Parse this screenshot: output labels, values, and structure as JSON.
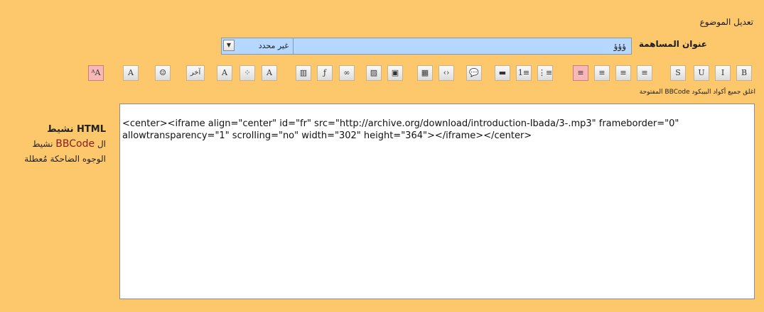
{
  "page_title": "تعديل الموضوع",
  "subject": {
    "label": "عنوان المساهمة",
    "value": "ؤؤؤ",
    "prefix_selected": "غير محدد"
  },
  "toolbar": {
    "buttons": [
      {
        "icon": "bold-icon",
        "glyph": "B"
      },
      {
        "icon": "italic-icon",
        "glyph": "I"
      },
      {
        "icon": "underline-icon",
        "glyph": "U"
      },
      {
        "icon": "strikethrough-icon",
        "glyph": "S"
      },
      {
        "icon": "align-right-icon",
        "glyph": "≡"
      },
      {
        "icon": "align-center-icon",
        "glyph": "≡"
      },
      {
        "icon": "align-left-icon",
        "glyph": "≡"
      },
      {
        "icon": "justify-icon",
        "glyph": "≡"
      },
      {
        "icon": "unordered-list-icon",
        "glyph": "⋮≡"
      },
      {
        "icon": "ordered-list-icon",
        "glyph": "1≡"
      },
      {
        "icon": "horizontal-rule-icon",
        "glyph": "▬"
      },
      {
        "icon": "quote-icon",
        "glyph": "💬"
      },
      {
        "icon": "code-icon",
        "glyph": "‹›"
      },
      {
        "icon": "table-icon",
        "glyph": "▦"
      },
      {
        "icon": "image-gallery-icon",
        "glyph": "▣"
      },
      {
        "icon": "image-icon",
        "glyph": "▨"
      },
      {
        "icon": "link-icon",
        "glyph": "∞"
      },
      {
        "icon": "flash-icon",
        "glyph": "ƒ"
      },
      {
        "icon": "video-icon",
        "glyph": "▥"
      },
      {
        "icon": "font-face-icon",
        "glyph": "A"
      },
      {
        "icon": "color-icon",
        "glyph": "⁘"
      },
      {
        "icon": "font-size-icon",
        "glyph": "A"
      },
      {
        "icon": "more-button",
        "glyph": "آخر"
      },
      {
        "icon": "emoticon-icon",
        "glyph": "☺"
      },
      {
        "icon": "remove-format-icon",
        "glyph": "A"
      },
      {
        "icon": "switch-editor-icon",
        "glyph": "ᴬA"
      }
    ]
  },
  "bbcode_hint": "اغلق جميع أكواد البيبكود BBCode المفتوحة",
  "status": {
    "html_line": "HTML نشيط",
    "bbcode_line_prefix": "ال",
    "bbcode_word": "BBCode",
    "bbcode_line_suffix": "نشيط",
    "smilies_line": "الوجوه الضاحكة مُعطلة"
  },
  "editor": {
    "content": "<center><iframe align=\"center\" id=\"fr\" src=\"http://archive.org/download/introduction-Ibada/3-.mp3\" frameborder=\"0\" allowtransparency=\"1\" scrolling=\"no\" width=\"302\" height=\"364\"></iframe></center>"
  },
  "colors": {
    "background": "#fdc76b",
    "subject_field": "#b6d7ff",
    "active_button": "#f8b8b8",
    "bbcode_accent": "#8b1a1a"
  }
}
